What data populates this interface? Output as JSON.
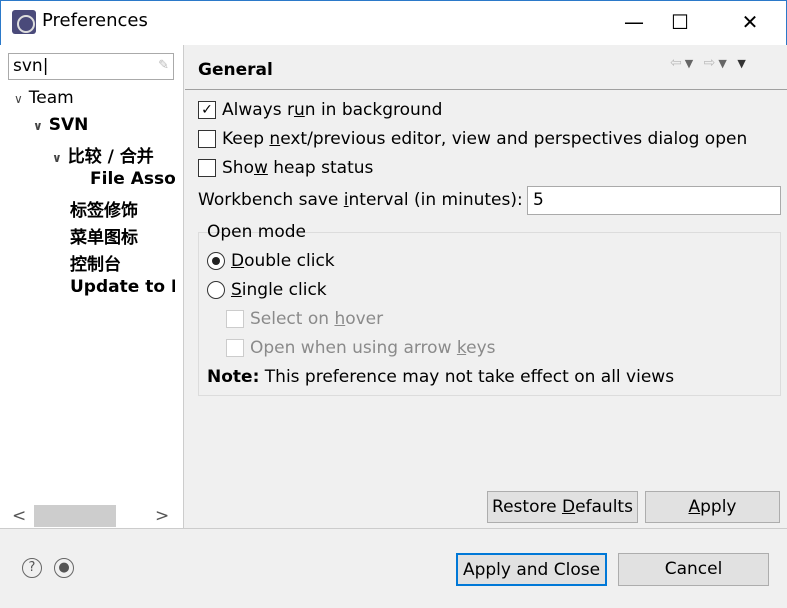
{
  "window": {
    "title": "Preferences",
    "min": "—",
    "max": "☐",
    "close": "✕"
  },
  "search": {
    "value": "svn"
  },
  "tree": [
    {
      "label": "Team",
      "bold": false
    },
    {
      "label": "SVN"
    },
    {
      "label": "比较 / 合并"
    },
    {
      "label": "File Associations"
    },
    {
      "label": "标签修饰"
    },
    {
      "label": "菜单图标"
    },
    {
      "label": "控制台"
    },
    {
      "label": "Update to HEAD"
    }
  ],
  "page": {
    "title": "General",
    "always_run": {
      "pre": "Always r",
      "u": "u",
      "post": "n in background",
      "checked": true
    },
    "keep_next": {
      "pre": "Keep ",
      "u": "n",
      "post": "ext/previous editor, view and perspectives dialog open",
      "checked": false
    },
    "show_heap": {
      "pre": "Sho",
      "u": "w",
      "post": " heap status",
      "checked": false
    },
    "interval": {
      "pre": "Workbench save ",
      "u": "i",
      "post": "nterval (in minutes):",
      "value": "5"
    },
    "open_mode": {
      "title": "Open mode",
      "double": {
        "u": "D",
        "post": "ouble click",
        "selected": true
      },
      "single": {
        "u": "S",
        "post": "ingle click",
        "selected": false
      },
      "hover": {
        "pre": "Select on ",
        "u": "h",
        "post": "over",
        "enabled": false
      },
      "arrow": {
        "pre": "Open when using arrow ",
        "u": "k",
        "post": "eys",
        "enabled": false
      },
      "note_bold": "Note:",
      "note": " This preference may not take effect on all views"
    }
  },
  "buttons": {
    "restore": {
      "pre": "Restore ",
      "u": "D",
      "post": "efaults"
    },
    "apply": {
      "u": "A",
      "post": "pply"
    },
    "apply_close": "Apply and Close",
    "cancel": "Cancel"
  }
}
